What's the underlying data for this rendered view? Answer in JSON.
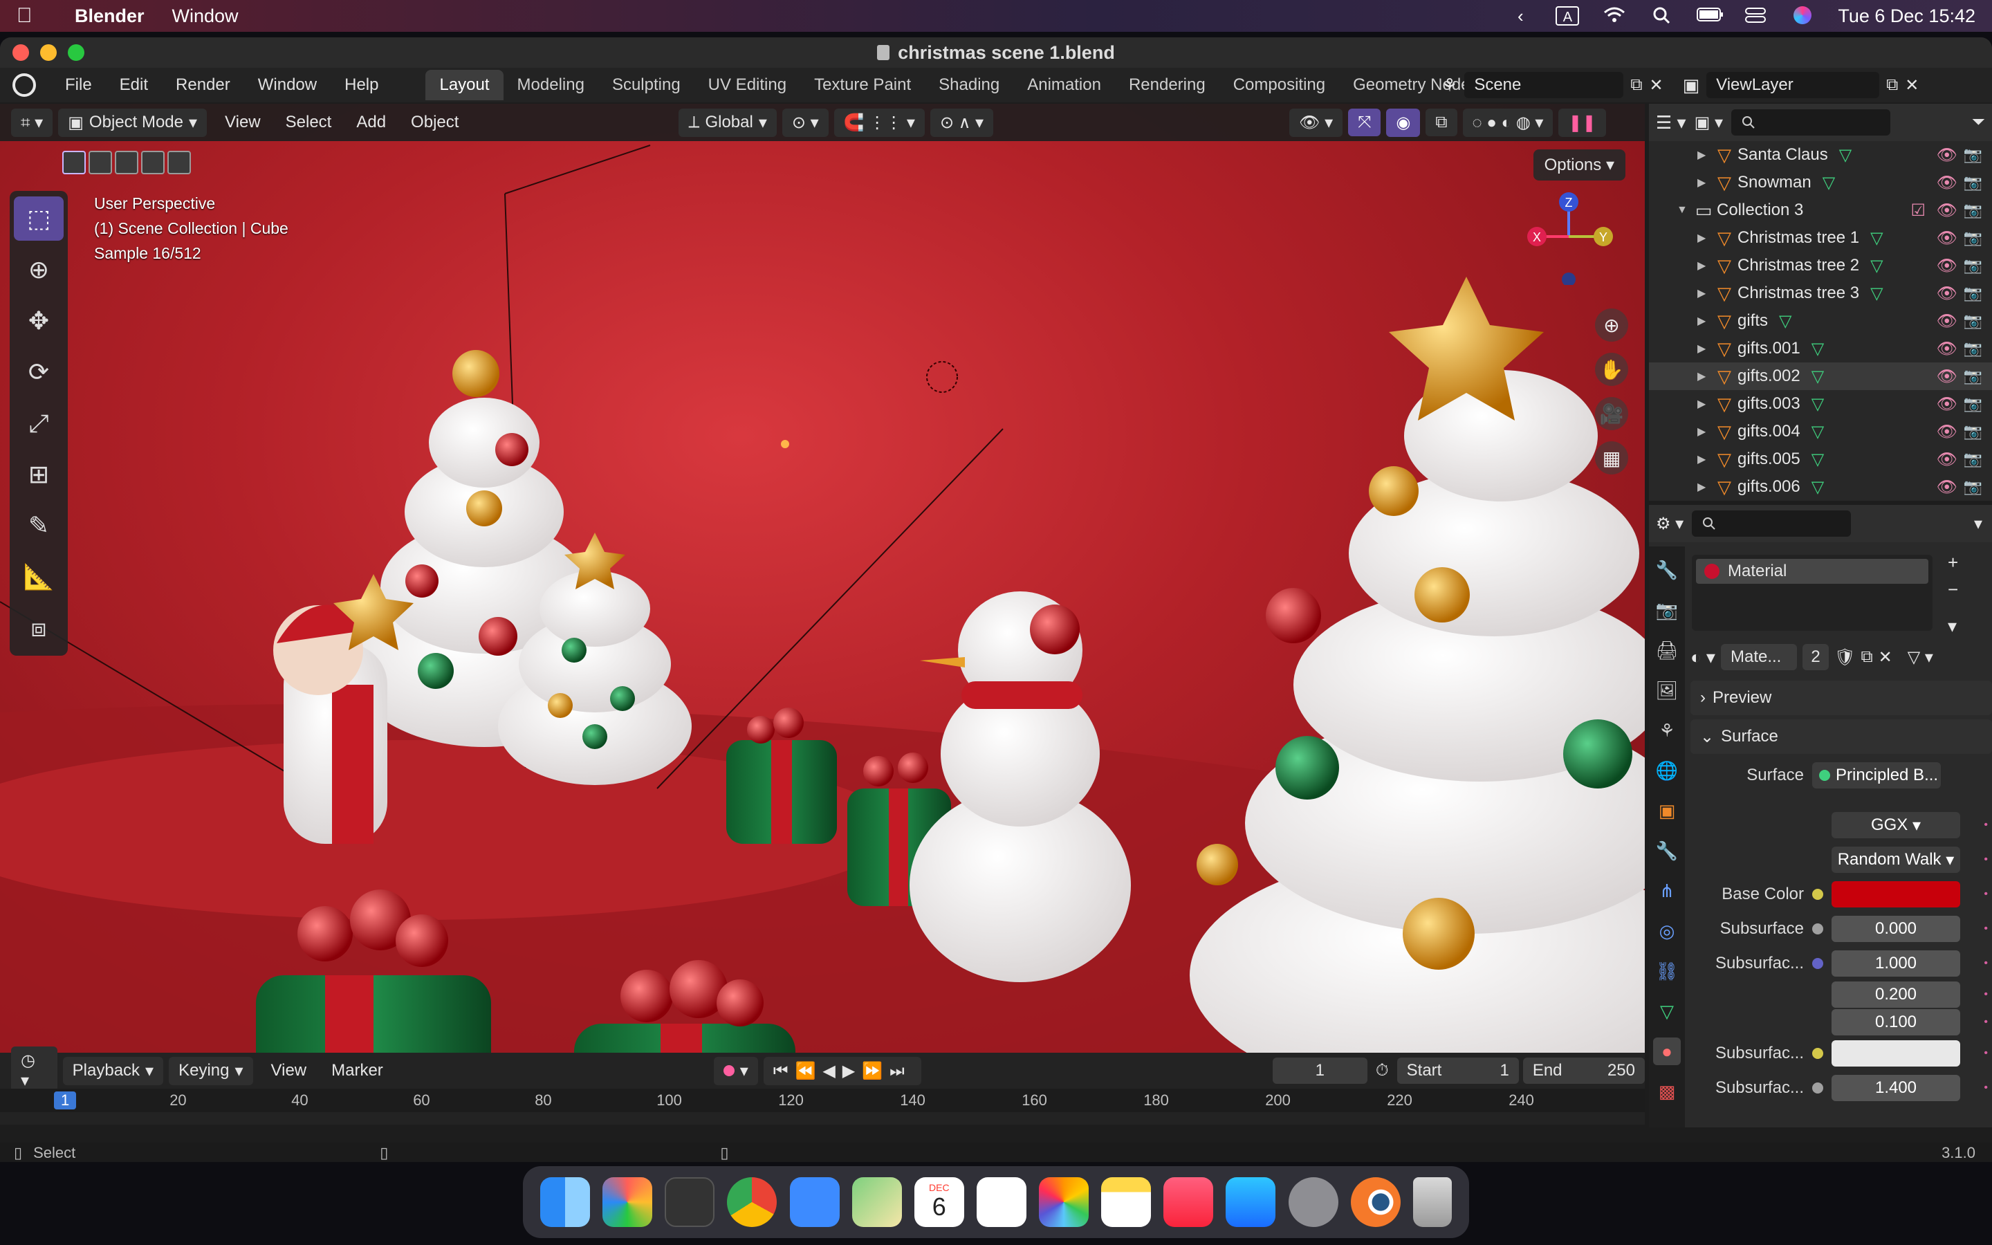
{
  "mac_menubar": {
    "apple": "",
    "app_name": "Blender",
    "menu": [
      "Window"
    ],
    "clock": "Tue 6 Dec  15:42",
    "input_source": "A"
  },
  "window": {
    "title": "christmas scene 1.blend"
  },
  "topbar": {
    "menus": [
      "File",
      "Edit",
      "Render",
      "Window",
      "Help"
    ],
    "workspaces": [
      "Layout",
      "Modeling",
      "Sculpting",
      "UV Editing",
      "Texture Paint",
      "Shading",
      "Animation",
      "Rendering",
      "Compositing",
      "Geometry Nodes"
    ],
    "active_workspace": "Layout",
    "scene": "Scene",
    "view_layer": "ViewLayer"
  },
  "viewport": {
    "mode": "Object Mode",
    "menus": [
      "View",
      "Select",
      "Add",
      "Object"
    ],
    "orientation": "Global",
    "options": "Options",
    "overlay_lines": [
      "User Perspective",
      "(1) Scene Collection | Cube",
      "Sample 16/512"
    ],
    "gizmo": {
      "x": "X",
      "y": "Y",
      "z": "Z"
    }
  },
  "outliner": {
    "rows": [
      {
        "label": "Santa Claus",
        "type": "object",
        "level": 2
      },
      {
        "label": "Snowman",
        "type": "object",
        "level": 2
      },
      {
        "label": "Collection 3",
        "type": "collection",
        "level": 1
      },
      {
        "label": "Christmas tree 1",
        "type": "object",
        "level": 2
      },
      {
        "label": "Christmas tree 2",
        "type": "object",
        "level": 2
      },
      {
        "label": "Christmas tree 3",
        "type": "object",
        "level": 2
      },
      {
        "label": "gifts",
        "type": "object",
        "level": 2
      },
      {
        "label": "gifts.001",
        "type": "object",
        "level": 2
      },
      {
        "label": "gifts.002",
        "type": "object",
        "level": 2,
        "selected": true
      },
      {
        "label": "gifts.003",
        "type": "object",
        "level": 2
      },
      {
        "label": "gifts.004",
        "type": "object",
        "level": 2
      },
      {
        "label": "gifts.005",
        "type": "object",
        "level": 2
      },
      {
        "label": "gifts.006",
        "type": "object",
        "level": 2
      }
    ]
  },
  "properties": {
    "material_slot": "Material",
    "material_name": "Mate...",
    "users": "2",
    "panels": {
      "preview": "Preview",
      "surface": "Surface"
    },
    "rows": [
      {
        "label": "Surface",
        "value": "Principled B...",
        "socket": "#3fcf7e"
      },
      {
        "label": "",
        "value": "GGX",
        "socket": ""
      },
      {
        "label": "",
        "value": "Random Walk",
        "socket": ""
      },
      {
        "label": "Base Color",
        "value": "",
        "socket": "#d4c84a",
        "swatch": "#c8000b"
      },
      {
        "label": "Subsurface",
        "value": "0.000",
        "socket": "#a0a0a0"
      },
      {
        "label": "Subsurfac...",
        "value": "1.000",
        "socket": "#6363c7"
      },
      {
        "label": "",
        "value": "0.200",
        "socket": ""
      },
      {
        "label": "",
        "value": "0.100",
        "socket": ""
      },
      {
        "label": "Subsurfac...",
        "value": "",
        "socket": "#d4c84a",
        "swatch": "#e8e8e8"
      },
      {
        "label": "Subsurfac...",
        "value": "1.400",
        "socket": "#a0a0a0"
      }
    ]
  },
  "timeline": {
    "menus": [
      "Playback",
      "Keying",
      "View",
      "Marker"
    ],
    "current_frame": "1",
    "start_label": "Start",
    "start": "1",
    "end_label": "End",
    "end": "250",
    "ticks": [
      "1",
      "20",
      "40",
      "60",
      "80",
      "100",
      "120",
      "140",
      "160",
      "180",
      "200",
      "220",
      "240"
    ]
  },
  "statusbar": {
    "left": "Select",
    "version": "3.1.0"
  },
  "dock": {
    "calendar_month": "DEC",
    "calendar_day": "6"
  }
}
